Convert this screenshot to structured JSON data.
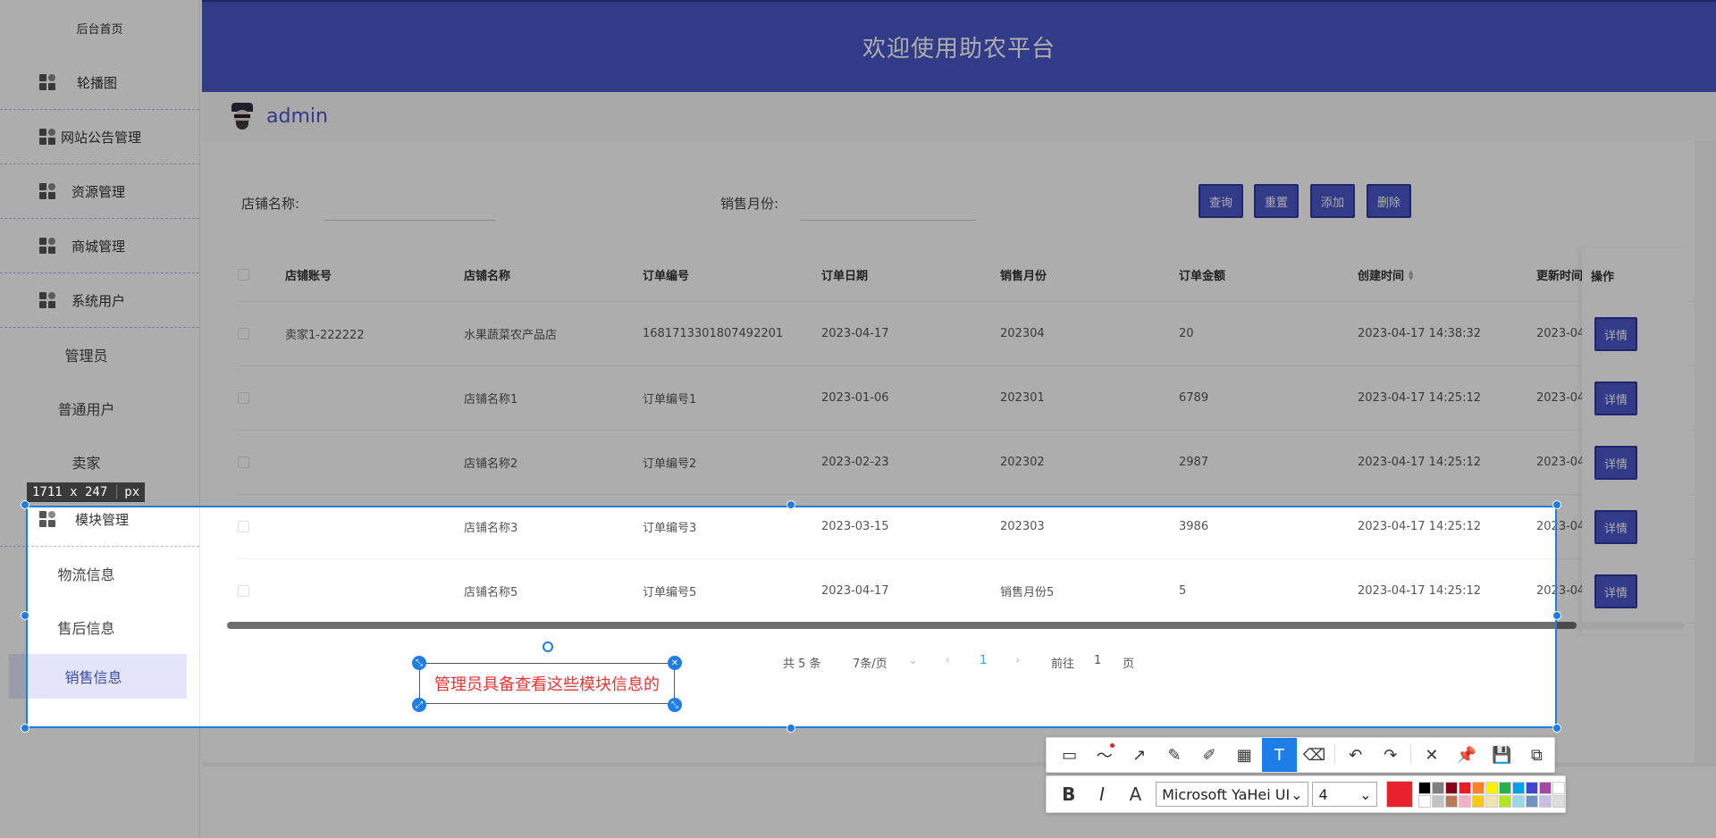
{
  "sidebar": {
    "home": "后台首页",
    "groups": [
      {
        "label": "轮播图"
      },
      {
        "label": "网站公告管理"
      },
      {
        "label": "资源管理"
      },
      {
        "label": "商城管理"
      },
      {
        "label": "系统用户"
      }
    ],
    "user_subitems": [
      "管理员",
      "普通用户",
      "卖家"
    ],
    "module_group": "模块管理",
    "module_subitems": [
      "物流信息",
      "售后信息",
      "销售信息"
    ]
  },
  "header": {
    "title": "欢迎使用助农平台"
  },
  "user": {
    "name": "admin"
  },
  "search": {
    "shop_label": "店铺名称:",
    "month_label": "销售月份:",
    "buttons": {
      "query": "查询",
      "reset": "重置",
      "add": "添加",
      "delete": "删除"
    }
  },
  "table": {
    "columns": [
      "店铺账号",
      "店铺名称",
      "订单编号",
      "订单日期",
      "销售月份",
      "订单金额",
      "创建时间",
      "更新时间",
      "操作"
    ],
    "rows": [
      {
        "account": "卖家1-222222",
        "shop": "水果蔬菜农产品店",
        "order_no": "1681713301807492201",
        "date": "2023-04-17",
        "month": "202304",
        "amount": "20",
        "created": "2023-04-17 14:38:32",
        "updated": "2023-04"
      },
      {
        "account": "",
        "shop": "店铺名称1",
        "order_no": "订单编号1",
        "date": "2023-01-06",
        "month": "202301",
        "amount": "6789",
        "created": "2023-04-17 14:25:12",
        "updated": "2023-04"
      },
      {
        "account": "",
        "shop": "店铺名称2",
        "order_no": "订单编号2",
        "date": "2023-02-23",
        "month": "202302",
        "amount": "2987",
        "created": "2023-04-17 14:25:12",
        "updated": "2023-04"
      },
      {
        "account": "",
        "shop": "店铺名称3",
        "order_no": "订单编号3",
        "date": "2023-03-15",
        "month": "202303",
        "amount": "3986",
        "created": "2023-04-17 14:25:12",
        "updated": "2023-04"
      },
      {
        "account": "",
        "shop": "店铺名称5",
        "order_no": "订单编号5",
        "date": "2023-04-17",
        "month": "销售月份5",
        "amount": "5",
        "created": "2023-04-17 14:25:12",
        "updated": "2023-04"
      }
    ],
    "detail_label": "详情"
  },
  "pager": {
    "total": "共 5 条",
    "page_size": "7条/页",
    "current": "1",
    "goto_prefix": "前往",
    "goto_value": "1",
    "goto_suffix": "页"
  },
  "screenshot_tool": {
    "size_label": "1711 x 247",
    "unit": "px",
    "annotation_text": "管理员具备查看这些模块信息的",
    "font_name": "Microsoft YaHei UI",
    "font_size": "4",
    "current_color": "#e8222c",
    "palette": [
      "#000000",
      "#7f7f7f",
      "#880015",
      "#ed1c24",
      "#ff7f27",
      "#fff200",
      "#22b14c",
      "#00a2e8",
      "#3f48cc",
      "#a349a4",
      "#ffffff",
      "#ffffff",
      "#c3c3c3",
      "#b97a57",
      "#ffaec9",
      "#ffc90e",
      "#efe4b0",
      "#b5e61d",
      "#99d9ea",
      "#7092be",
      "#c8bfe7",
      "#dddddd"
    ],
    "tools": [
      "shape-icon",
      "line-icon",
      "arrow-icon",
      "pen-icon",
      "marker-icon",
      "mosaic-icon",
      "text-icon",
      "eraser-icon",
      "undo-icon",
      "redo-icon",
      "close-icon",
      "pin-icon",
      "save-icon",
      "copy-icon"
    ]
  }
}
